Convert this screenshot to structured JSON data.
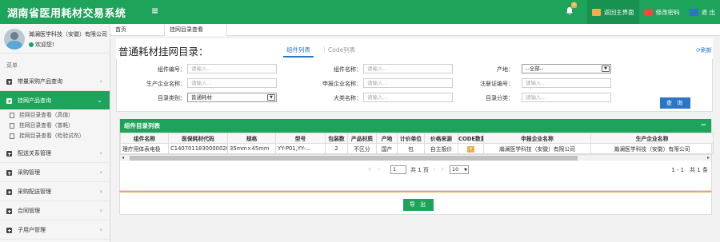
{
  "header": {
    "brand": "湖南省医用耗材交易系统",
    "menu_toggle": "≡",
    "notification_count": "0",
    "home_btn": "返回主界面",
    "password_btn": "修改密码",
    "logout_btn": "退 出"
  },
  "sidebar": {
    "user_name": "瀚澜医学科技（安徽）有限公司",
    "welcome": "欢迎您!",
    "menu_title": "菜单",
    "items": [
      {
        "label": "带量采购产品查询"
      },
      {
        "label": "挂网产品查询"
      },
      {
        "label": "配送关系管理"
      },
      {
        "label": "采购管理"
      },
      {
        "label": "采购配送管理"
      },
      {
        "label": "合同管理"
      },
      {
        "label": "子用户管理"
      }
    ],
    "sub_items": [
      {
        "label": "挂网目录查看（高值）"
      },
      {
        "label": "挂网目录查看（普耗）"
      },
      {
        "label": "挂网目录查看（检验试剂）"
      }
    ]
  },
  "tabs": {
    "home": "首页",
    "current": "挂网目录查看（..."
  },
  "page": {
    "title": "普通耗材挂网目录：",
    "tab_components": "组件列表",
    "tab_code": "Code列表",
    "refresh": "刷新"
  },
  "form": {
    "component_no": {
      "label": "组件编号：",
      "placeholder": "请输入..."
    },
    "component_name": {
      "label": "组件名称：",
      "placeholder": "请输入..."
    },
    "origin": {
      "label": "产地：",
      "value": "--全部--"
    },
    "manufacturer": {
      "label": "生产企业名称：",
      "placeholder": "请输入..."
    },
    "applicant": {
      "label": "申报企业名称：",
      "placeholder": "请输入..."
    },
    "reg_no": {
      "label": "注册证编号：",
      "placeholder": "请输入..."
    },
    "catalog_type": {
      "label": "目录类别：",
      "value": "普通耗材"
    },
    "category": {
      "label": "大类名称：",
      "placeholder": "请输入..."
    },
    "catalog_class": {
      "label": "目录分类：",
      "placeholder": "请输入..."
    },
    "query_btn": "查 询"
  },
  "panel": {
    "title": "组件目录列表",
    "collapse": "−"
  },
  "table": {
    "headers": [
      "组件名称",
      "医保耗材代码",
      "规格",
      "型号",
      "包装数",
      "产品材质",
      "产地",
      "计价单位",
      "价格来源",
      "CODE数量",
      "申报企业名称",
      "生产企业名称"
    ],
    "rows": [
      [
        "理疗用体表电极",
        "C1407011830000020",
        "35mm×45mm",
        "YY-P01,YY-...",
        "2",
        "不区分",
        "国产",
        "包",
        "自主报价",
        "4",
        "瀚澜医学科技（安徽）有限公司",
        "瀚澜医学科技（安徽）有限公司"
      ]
    ]
  },
  "pager": {
    "page_input": "1",
    "of_pages": "共 1 页",
    "page_size": "10",
    "info": "1 - 1　共 1 条"
  },
  "export_btn": "导 出",
  "colors": {
    "brand_green": "#1ea35a",
    "link_blue": "#2a76c6",
    "accent_orange": "#f0ad4e"
  }
}
